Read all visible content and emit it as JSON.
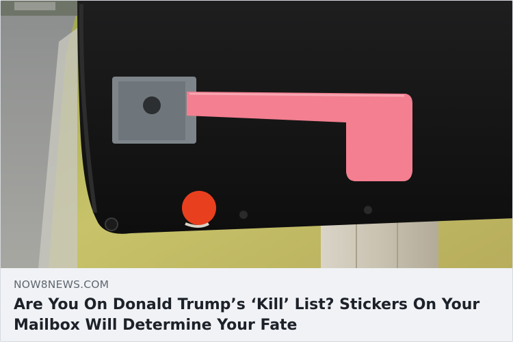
{
  "link_preview": {
    "image": {
      "description": "Black rural mailbox with pink flag and red round sticker on wooden post",
      "colors": {
        "mailbox": "#141414",
        "flag": "#f37f90",
        "sticker": "#e8401e",
        "grass": "#b9b55c",
        "pavement": "#9a9b98"
      }
    },
    "source": "NOW8NEWS.COM",
    "headline": "Are You On Donald Trump’s ‘Kill’ List? Stickers On Your Mailbox Will Determine Your Fate"
  }
}
